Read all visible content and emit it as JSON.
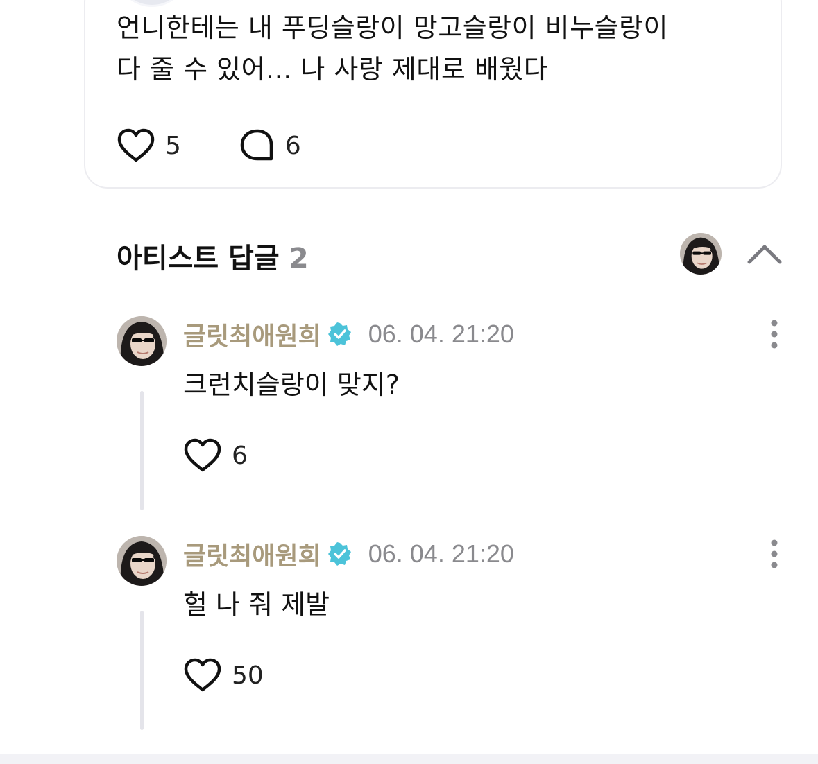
{
  "post": {
    "text_line1": "언니한테는 내 푸딩슬랑이 망고슬랑이 비누슬랑이",
    "text_line2": "다 줄 수 있어... 나 사랑 제대로 배웠다",
    "likes": "5",
    "comments": "6"
  },
  "artist_replies": {
    "title": "아티스트 답글",
    "count": "2",
    "replies": [
      {
        "author": "글릿최애원희",
        "time": "06. 04. 21:20",
        "text": "크런치슬랑이 맞지?",
        "likes": "6"
      },
      {
        "author": "글릿최애원희",
        "time": "06. 04. 21:20",
        "text": "헐 나 줘 제발",
        "likes": "50"
      }
    ]
  },
  "colors": {
    "author_name": "#a89a7c",
    "verified_badge": "#4cc3d9",
    "muted_text": "#8a8a8e",
    "thread_line": "#e4e4ea",
    "card_border": "#ececf0"
  },
  "icons": {
    "like": "heart-outline-icon",
    "comment": "speech-bubble-icon",
    "collapse": "chevron-up-icon",
    "more": "vertical-ellipsis-icon",
    "verified": "verified-badge-icon"
  }
}
